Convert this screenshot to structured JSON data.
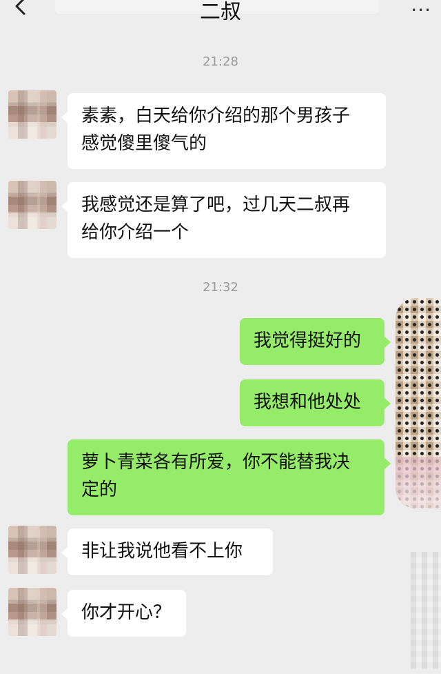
{
  "header": {
    "title": "二叔",
    "back_icon": "chevron-left-icon",
    "more_label": "···"
  },
  "timestamps": [
    "21:28",
    "21:32"
  ],
  "messages": [
    {
      "side": "left",
      "lines": [
        "素素，白天给你介绍的那个男孩子",
        "感觉傻里傻气的"
      ]
    },
    {
      "side": "left",
      "lines": [
        "我感觉还是算了吧，过几天二叔再",
        "给你介绍一个"
      ]
    },
    {
      "side": "right",
      "lines": [
        "我觉得挺好的"
      ]
    },
    {
      "side": "right",
      "lines": [
        "我想和他处处"
      ]
    },
    {
      "side": "right",
      "lines": [
        "萝卜青菜各有所爱，你不能替我决",
        "定的"
      ]
    },
    {
      "side": "left",
      "lines": [
        "非让我说他看不上你"
      ]
    },
    {
      "side": "left",
      "lines": [
        "你才开心？"
      ]
    }
  ],
  "colors": {
    "background": "#ededed",
    "left_bubble": "#ffffff",
    "right_bubble": "#95ec69",
    "timestamp_text": "#9a9a9a"
  }
}
